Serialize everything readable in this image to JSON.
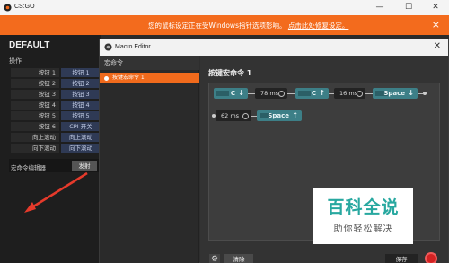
{
  "app": {
    "title": "CS:GO",
    "window_controls": [
      "—",
      "☐",
      "✕"
    ]
  },
  "notice": {
    "message": "您的鼠标设定正在受Windows指针选项影响。",
    "link": "点击此处修复设定。",
    "close": "×"
  },
  "left_panel": {
    "title": "DEFAULT",
    "subtitle": "操作",
    "rows": [
      {
        "key": "按钮 1",
        "value": "按钮 1"
      },
      {
        "key": "按钮 2",
        "value": "按钮 2"
      },
      {
        "key": "按钮 3",
        "value": "按钮 3"
      },
      {
        "key": "按钮 4",
        "value": "按钮 4"
      },
      {
        "key": "按钮 5",
        "value": "按钮 5"
      },
      {
        "key": "按钮 6",
        "value": "CPI 开关"
      },
      {
        "key": "向上滚动",
        "value": "向上滚动"
      },
      {
        "key": "向下滚动",
        "value": "向下滚动"
      }
    ],
    "macro_editor_label": "宏命令编辑器",
    "fire_button": "发射"
  },
  "editor": {
    "title": "Macro Editor",
    "close": "✕",
    "list_header": "宏命令",
    "macros": [
      "按键宏命令 1"
    ],
    "heading": "按键宏命令 1",
    "sequence": {
      "key1": "C",
      "key1_dir": "↓",
      "delay1": "78 ms",
      "key2": "C",
      "key2_dir": "↑",
      "delay2": "16 ms",
      "key3": "Space",
      "key3_dir": "↓",
      "delay3": "62 ms",
      "key4": "Space",
      "key4_dir": "↑"
    },
    "clear_button": "清除",
    "save_button": "保存",
    "gear": "⚙"
  },
  "watermark": {
    "big": "百科全说",
    "small": "助你轻松解决"
  },
  "colors": {
    "accent": "#f36b1d",
    "key_block": "#3d7f87",
    "record": "#d32222"
  }
}
